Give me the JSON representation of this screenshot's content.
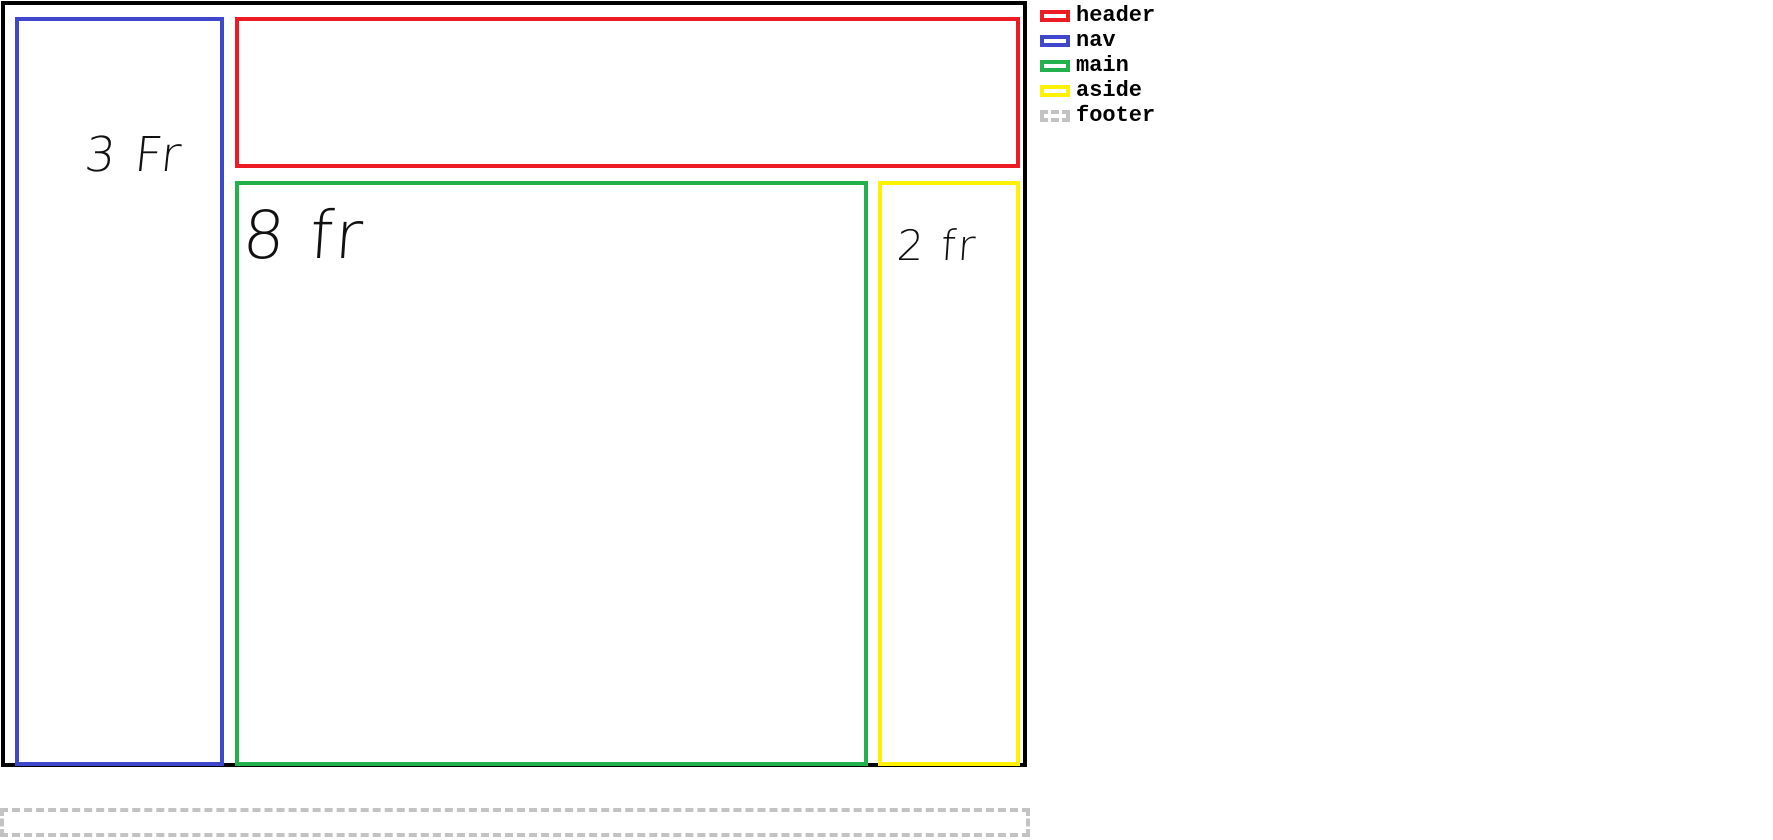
{
  "layout_regions": [
    {
      "id": "nav",
      "label": "3 Fr",
      "color": "#3f48cc",
      "style": "solid"
    },
    {
      "id": "header",
      "label": "",
      "color": "#ed1c24",
      "style": "solid"
    },
    {
      "id": "main",
      "label": "8 fr",
      "color": "#22b14c",
      "style": "solid"
    },
    {
      "id": "aside",
      "label": "2 fr",
      "color": "#fff200",
      "style": "solid"
    },
    {
      "id": "footer",
      "label": "",
      "color": "#c3c3c3",
      "style": "dashed"
    }
  ],
  "annotations": {
    "nav": "3 Fr",
    "main": "8 fr",
    "aside": "2 fr"
  },
  "legend": {
    "items": [
      {
        "label": "header",
        "color": "#ed1c24",
        "style": "solid"
      },
      {
        "label": "nav",
        "color": "#3f48cc",
        "style": "solid"
      },
      {
        "label": "main",
        "color": "#22b14c",
        "style": "solid"
      },
      {
        "label": "aside",
        "color": "#fff200",
        "style": "solid"
      },
      {
        "label": "footer",
        "color": "#c3c3c3",
        "style": "dashed"
      }
    ]
  },
  "colors": {
    "frame": "#000000",
    "background": "#ffffff"
  }
}
